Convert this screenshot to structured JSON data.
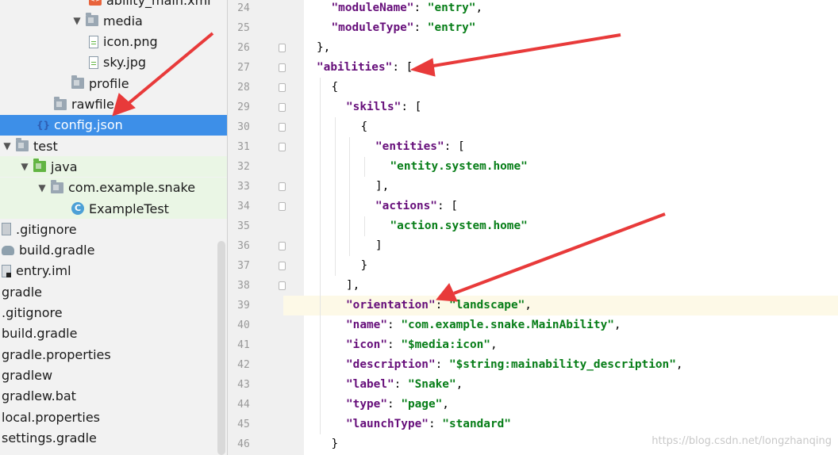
{
  "tree": {
    "items": [
      {
        "label": "ability_main.xml",
        "icon": "xml-file-icon",
        "indent": 5
      },
      {
        "label": "media",
        "icon": "folder-icon",
        "arrow": "▼",
        "indent": 4
      },
      {
        "label": "icon.png",
        "icon": "image-file-icon",
        "indent": 5
      },
      {
        "label": "sky.jpg",
        "icon": "image-file-icon",
        "indent": 5
      },
      {
        "label": "profile",
        "icon": "folder-icon",
        "indent": 4
      },
      {
        "label": "rawfile",
        "icon": "folder-icon",
        "indent": 3
      },
      {
        "label": "config.json",
        "icon": "json-file-icon",
        "indent": 2,
        "selected": true
      },
      {
        "label": "test",
        "icon": "folder-icon",
        "arrow": "▼",
        "indent": 0
      },
      {
        "label": "java",
        "icon": "green-folder-icon",
        "arrow": "▼",
        "indent": 1,
        "group": "test"
      },
      {
        "label": "com.example.snake",
        "icon": "package-folder-icon",
        "arrow": "▼",
        "indent": 2,
        "group": "test"
      },
      {
        "label": "ExampleTest",
        "icon": "java-class-icon",
        "indent": 4,
        "group": "test"
      },
      {
        "label": ".gitignore",
        "icon": "gitignore-file-icon",
        "indent": 0
      },
      {
        "label": "build.gradle",
        "icon": "gradle-icon",
        "indent": 0
      },
      {
        "label": "entry.iml",
        "icon": "iml-file-icon",
        "indent": 0
      },
      {
        "label": "gradle",
        "icon": "",
        "indent": -1
      },
      {
        "label": ".gitignore",
        "icon": "",
        "indent": -1
      },
      {
        "label": "build.gradle",
        "icon": "",
        "indent": -1
      },
      {
        "label": "gradle.properties",
        "icon": "",
        "indent": -1
      },
      {
        "label": "gradlew",
        "icon": "",
        "indent": -1
      },
      {
        "label": "gradlew.bat",
        "icon": "",
        "indent": -1
      },
      {
        "label": "local.properties",
        "icon": "",
        "indent": -1
      },
      {
        "label": "settings.gradle",
        "icon": "",
        "indent": -1
      }
    ]
  },
  "editor": {
    "highlighted_line": 39,
    "lines": [
      {
        "n": "24",
        "indent": 1,
        "tokens": [
          [
            "k",
            "\"moduleName\""
          ],
          [
            "p",
            ": "
          ],
          [
            "s",
            "\"entry\""
          ],
          [
            "p",
            ","
          ]
        ]
      },
      {
        "n": "25",
        "indent": 1,
        "tokens": [
          [
            "k",
            "\"moduleType\""
          ],
          [
            "p",
            ": "
          ],
          [
            "s",
            "\"entry\""
          ]
        ]
      },
      {
        "n": "26",
        "indent": 0,
        "tokens": [
          [
            "p",
            "},"
          ]
        ]
      },
      {
        "n": "27",
        "indent": 0,
        "tokens": [
          [
            "k",
            "\"abilities\""
          ],
          [
            "p",
            ": ["
          ]
        ]
      },
      {
        "n": "28",
        "indent": 1,
        "tokens": [
          [
            "p",
            "{"
          ]
        ]
      },
      {
        "n": "29",
        "indent": 2,
        "tokens": [
          [
            "k",
            "\"skills\""
          ],
          [
            "p",
            ": ["
          ]
        ]
      },
      {
        "n": "30",
        "indent": 3,
        "tokens": [
          [
            "p",
            "{"
          ]
        ]
      },
      {
        "n": "31",
        "indent": 4,
        "tokens": [
          [
            "k",
            "\"entities\""
          ],
          [
            "p",
            ": ["
          ]
        ]
      },
      {
        "n": "32",
        "indent": 5,
        "tokens": [
          [
            "s",
            "\"entity.system.home\""
          ]
        ]
      },
      {
        "n": "33",
        "indent": 4,
        "tokens": [
          [
            "p",
            "],"
          ]
        ]
      },
      {
        "n": "34",
        "indent": 4,
        "tokens": [
          [
            "k",
            "\"actions\""
          ],
          [
            "p",
            ": ["
          ]
        ]
      },
      {
        "n": "35",
        "indent": 5,
        "tokens": [
          [
            "s",
            "\"action.system.home\""
          ]
        ]
      },
      {
        "n": "36",
        "indent": 4,
        "tokens": [
          [
            "p",
            "]"
          ]
        ]
      },
      {
        "n": "37",
        "indent": 3,
        "tokens": [
          [
            "p",
            "}"
          ]
        ]
      },
      {
        "n": "38",
        "indent": 2,
        "tokens": [
          [
            "p",
            "],"
          ]
        ]
      },
      {
        "n": "39",
        "indent": 2,
        "tokens": [
          [
            "k",
            "\"orientation\""
          ],
          [
            "p",
            ": "
          ],
          [
            "s",
            "\"landscape\""
          ],
          [
            "p",
            ","
          ]
        ]
      },
      {
        "n": "40",
        "indent": 2,
        "tokens": [
          [
            "k",
            "\"name\""
          ],
          [
            "p",
            ": "
          ],
          [
            "s",
            "\"com.example.snake.MainAbility\""
          ],
          [
            "p",
            ","
          ]
        ]
      },
      {
        "n": "41",
        "indent": 2,
        "tokens": [
          [
            "k",
            "\"icon\""
          ],
          [
            "p",
            ": "
          ],
          [
            "s",
            "\"$media:icon\""
          ],
          [
            "p",
            ","
          ]
        ]
      },
      {
        "n": "42",
        "indent": 2,
        "tokens": [
          [
            "k",
            "\"description\""
          ],
          [
            "p",
            ": "
          ],
          [
            "s",
            "\"$string:mainability_description\""
          ],
          [
            "p",
            ","
          ]
        ]
      },
      {
        "n": "43",
        "indent": 2,
        "tokens": [
          [
            "k",
            "\"label\""
          ],
          [
            "p",
            ": "
          ],
          [
            "s",
            "\"Snake\""
          ],
          [
            "p",
            ","
          ]
        ]
      },
      {
        "n": "44",
        "indent": 2,
        "tokens": [
          [
            "k",
            "\"type\""
          ],
          [
            "p",
            ": "
          ],
          [
            "s",
            "\"page\""
          ],
          [
            "p",
            ","
          ]
        ]
      },
      {
        "n": "45",
        "indent": 2,
        "tokens": [
          [
            "k",
            "\"launchType\""
          ],
          [
            "p",
            ": "
          ],
          [
            "s",
            "\"standard\""
          ]
        ]
      },
      {
        "n": "46",
        "indent": 1,
        "tokens": [
          [
            "p",
            "}"
          ]
        ]
      }
    ]
  },
  "watermark": "https://blog.csdn.net/longzhanqing",
  "colors": {
    "key": "#660e7a",
    "string": "#067d17",
    "selection": "#3d8fe8",
    "annotation_arrow": "#e83a3a"
  }
}
